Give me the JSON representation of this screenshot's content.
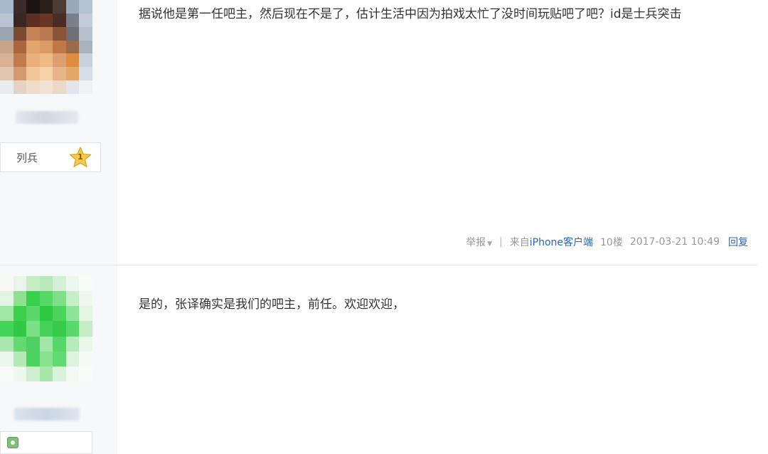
{
  "posts": [
    {
      "avatar_palette": [
        [
          "#a8b8cc",
          "#3a2a2a",
          "#1c1412",
          "#2a1e1a",
          "#4a3b35",
          "#9aa8bc",
          "#b5c2d2"
        ],
        [
          "#b8c4d2",
          "#3a2622",
          "#5a2e24",
          "#6b3526",
          "#4a2c24",
          "#7a7f8a",
          "#c3ccd8"
        ],
        [
          "#9aa4b0",
          "#7a4a30",
          "#c48456",
          "#b87a4e",
          "#8a5436",
          "#6e6f78",
          "#b7c1cd"
        ],
        [
          "#c7a488",
          "#a8643a",
          "#e2a46e",
          "#d99c66",
          "#c07846",
          "#9a6a4a",
          "#a9b3bf"
        ],
        [
          "#d8b292",
          "#c07c4c",
          "#eab07c",
          "#f0bc86",
          "#dca070",
          "#e08c40",
          "#c8d2de"
        ],
        [
          "#e2c6ae",
          "#d49a72",
          "#f2c69a",
          "#f6d2a8",
          "#e8b48a",
          "#e4a868",
          "#d6dde6"
        ],
        [
          "#e9ecf1",
          "#e6d2c2",
          "#f0dccb",
          "#f3e2d2",
          "#ecd8c6",
          "#e2e6ec",
          "#eef1f5"
        ]
      ],
      "level_text": "列兵",
      "level_number": "1",
      "content": "据说他是第一任吧主，然后现在不是了，估计生活中因为拍戏太忙了没时间玩贴吧了吧？id是士兵突击",
      "tail": {
        "report": "举报",
        "from": "来自",
        "client": "iPhone客户端",
        "floor": "10楼",
        "time": "2017-03-21 10:49",
        "reply": "回复"
      }
    },
    {
      "avatar_palette": [
        [
          "#f6f9f6",
          "#eaf5ea",
          "#c6ecc6",
          "#b8e8bc",
          "#d2f0d4",
          "#eef7ee",
          "#f7faf7"
        ],
        [
          "#e4f4e4",
          "#8fe08f",
          "#38d24a",
          "#56d866",
          "#7fe08a",
          "#c6eec8",
          "#eff8ef"
        ],
        [
          "#9ee6a2",
          "#3cd04c",
          "#5ad86a",
          "#2ec842",
          "#4ad45c",
          "#8ee496",
          "#e4f5e4"
        ],
        [
          "#42d456",
          "#30c844",
          "#7ce086",
          "#44d258",
          "#36cc4a",
          "#5ad86c",
          "#c2edc6"
        ],
        [
          "#a8e8ae",
          "#62da72",
          "#4ed062",
          "#a2e6a8",
          "#58d66a",
          "#b6ecbc",
          "#eaf7ea"
        ],
        [
          "#eaf7ea",
          "#b2eab6",
          "#4cd25e",
          "#88e290",
          "#62da72",
          "#dff3e0",
          "#f6faf6"
        ],
        [
          "#f7faf7",
          "#eef8ee",
          "#cdeecf",
          "#a8e6ac",
          "#daf2dc",
          "#f3f9f3",
          "#f8fbf8"
        ]
      ],
      "content": "是的，张译确实是我们的吧主，前任。欢迎欢迎，"
    }
  ],
  "colors": {
    "accent_link": "#2d64b3",
    "meta_gray": "#999999",
    "sidebar_bg": "#f7f8fa",
    "star_fill": "#f6c94c"
  }
}
